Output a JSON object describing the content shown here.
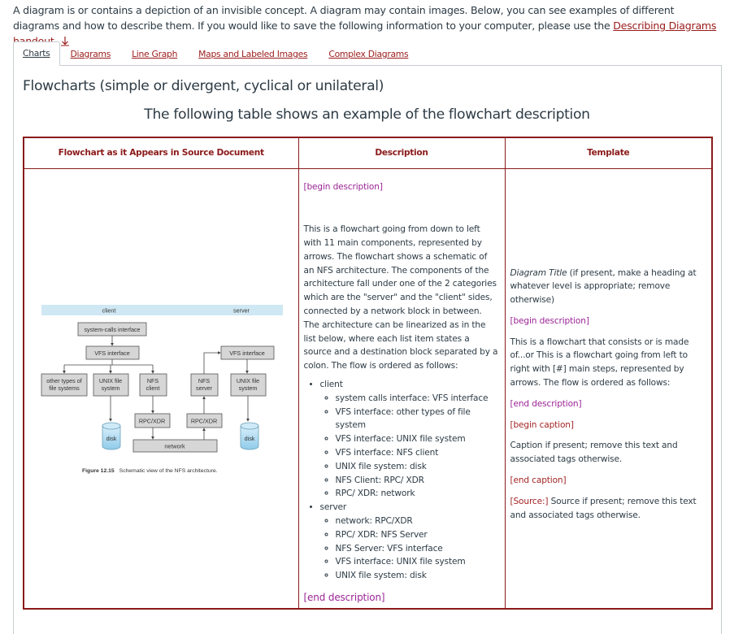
{
  "intro": {
    "text_before_link": "A diagram is or contains a depiction of an invisible concept. A diagram may contain images. Below, you can see examples of different diagrams and how to describe them.  If you would like to save the following information to your computer, please use the ",
    "link_label": "Describing Diagrams handout.",
    "link_icon": "download-arrow-icon"
  },
  "tabs": [
    {
      "label": "Charts",
      "active": true
    },
    {
      "label": "Diagrams",
      "active": false
    },
    {
      "label": "Line Graph",
      "active": false
    },
    {
      "label": "Maps and Labeled Images",
      "active": false
    },
    {
      "label": "Complex Diagrams",
      "active": false
    }
  ],
  "section_title": "Flowcharts (simple or divergent, cyclical or unilateral)",
  "table_caption": "The following table shows an example of the flowchart description",
  "table": {
    "headers": [
      "Flowchart as it Appears in Source Document",
      "Description",
      "Template"
    ],
    "figure": {
      "band_labels": {
        "client": "client",
        "server": "server"
      },
      "boxes": {
        "syscalls": "system-calls interface",
        "vfs_client": "VFS interface",
        "vfs_server": "VFS interface",
        "other_fs_1": "other types of",
        "other_fs_2": "file systems",
        "unix_client_1": "UNIX file",
        "unix_client_2": "system",
        "nfs_client_1": "NFS",
        "nfs_client_2": "client",
        "nfs_server_1": "NFS",
        "nfs_server_2": "server",
        "unix_server_1": "UNIX file",
        "unix_server_2": "system",
        "rpc_client": "RPC/XDR",
        "rpc_server": "RPC/XDR",
        "disk_client": "disk",
        "disk_server": "disk",
        "network": "network"
      },
      "caption_label": "Figure 12.15",
      "caption_text": "Schematic view of the NFS architecture."
    },
    "description": {
      "begin_tag": "[begin description]",
      "paragraph": "This is a flowchart going from down to left with 11 main components, represented by arrows. The flowchart shows a schematic of an NFS architecture. The components of the architecture fall under one of the 2 categories which are the \"server\" and the \"client\" sides, connected by a network block in between. The architecture can be linearized as in the list below, where each list item states a source and a destination block separated by a colon. The flow is ordered as follows:",
      "groups": [
        {
          "label": "client",
          "items": [
            "system calls interface: VFS interface",
            "VFS interface: other types of file system",
            "VFS interface: UNIX file system",
            "VFS interface: NFS client",
            "UNIX file system: disk",
            "NFS Client: RPC/ XDR",
            "RPC/ XDR: network"
          ]
        },
        {
          "label": "server",
          "items": [
            "network: RPC/XDR",
            "RPC/ XDR: NFS Server",
            "NFS Server: VFS interface",
            "VFS interface: UNIX file system",
            "UNIX file system: disk"
          ]
        }
      ],
      "end_tag": "[end description]"
    },
    "template": {
      "title_italic": "Diagram Title",
      "title_rest": " (if present, make a heading at whatever level is appropriate; remove otherwise)",
      "begin_desc": "[begin description]",
      "body": "This is a flowchart that consists or is made of...or This is a flowchart going from left to right with [#] main steps, represented by arrows. The flow is ordered as follows:",
      "end_desc": "[end description]",
      "begin_caption": "[begin caption]",
      "caption_body": "Caption if present; remove this text and associated tags otherwise.",
      "end_caption": "[end caption]",
      "source_tag": "[Source:]",
      "source_body": " Source if present; remove this text and associated tags otherwise."
    }
  },
  "colors": {
    "accent": "#8b1a1a",
    "link": "#9b1b1b",
    "tag_purple": "#9a2596",
    "tag_red": "#a32525",
    "text": "#2d3b45",
    "band": "#cfe8f3",
    "box": "#d6d6d6"
  }
}
